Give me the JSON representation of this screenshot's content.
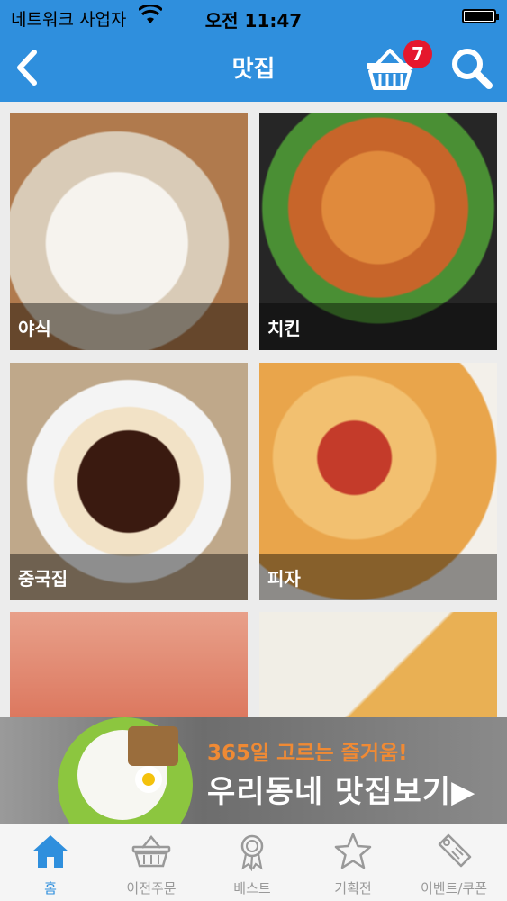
{
  "status": {
    "carrier": "네트워크 사업자",
    "time": "오전 11:47"
  },
  "nav": {
    "title": "맛집",
    "cart_count": "7"
  },
  "categories": [
    {
      "label": "야식"
    },
    {
      "label": "치킨"
    },
    {
      "label": "중국집"
    },
    {
      "label": "피자"
    },
    {
      "label": ""
    },
    {
      "label": ""
    }
  ],
  "banner": {
    "line1": "365일 고르는 즐거움!",
    "line2": "우리동네 맛집보기▶"
  },
  "tabs": [
    {
      "label": "홈",
      "icon": "home-icon",
      "active": true
    },
    {
      "label": "이전주문",
      "icon": "basket-icon"
    },
    {
      "label": "베스트",
      "icon": "award-icon"
    },
    {
      "label": "기획전",
      "icon": "star-icon"
    },
    {
      "label": "이벤트/쿠폰",
      "icon": "tag-icon"
    }
  ],
  "colors": {
    "accent": "#2f8fdd",
    "badge": "#e5172d",
    "banner_highlight": "#f08a34"
  }
}
